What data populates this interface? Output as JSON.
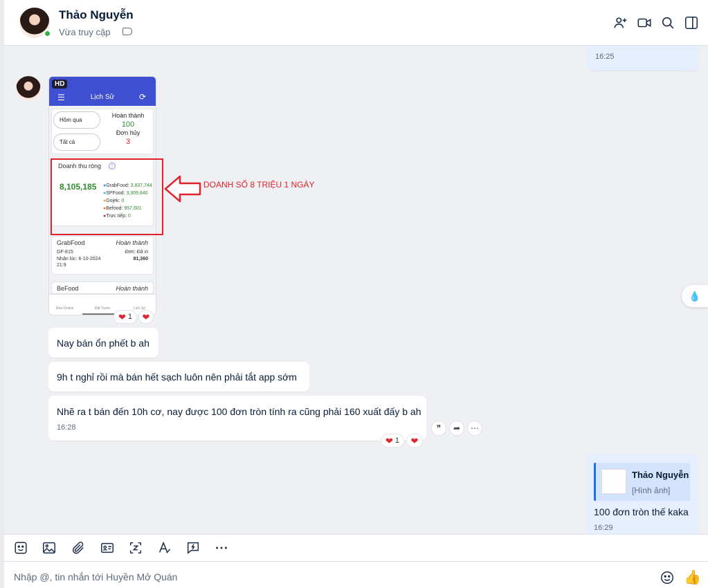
{
  "header": {
    "contact_name": "Thảo Nguyễn",
    "status": "Vừa truy cập"
  },
  "chat": {
    "top_time": "16:25",
    "image_message": {
      "hd_badge": "HD",
      "app_title": "Lịch Sử",
      "filter_yesterday": "Hôm qua",
      "filter_all": "Tất cả",
      "completed_label": "Hoàn thành",
      "completed_count": "100",
      "cancelled_label": "Đơn hủy",
      "cancelled_count": "3",
      "revenue_label": "Doanh thu ròng",
      "revenue_total": "8,105,185",
      "breakdown": [
        {
          "label": "GrabFood:",
          "value": "3,837,744",
          "color": "#3a8ee6"
        },
        {
          "label": "SPFood:",
          "value": "3,309,840",
          "color": "#35c6c9"
        },
        {
          "label": "Gojek:",
          "value": "0",
          "color": "#f2a93b"
        },
        {
          "label": "Befood:",
          "value": "957,601",
          "color": "#f7791e"
        },
        {
          "label": "Trực tiếp:",
          "value": "0",
          "color": "#c2187f"
        }
      ],
      "order1_platform": "GrabFood",
      "order1_status": "Hoàn thành",
      "order1_code": "GF-815",
      "order1_print": "Đơn: Đã in",
      "order1_received": "Nhận lúc: 6-10-2024",
      "order1_time": "21:9",
      "order1_amount": "81,360",
      "order2_platform": "BeFood",
      "order2_status": "Hoàn thành",
      "tabs": [
        "Đơn Online",
        "Đặt Trước",
        "Lịch Sử"
      ],
      "reaction_count": "1"
    },
    "annotation": "DOANH SỐ 8 TRIỆU 1 NGÀY",
    "messages": [
      {
        "text": "Nay bán ổn phết b ah"
      },
      {
        "text": "9h t nghỉ rồi mà bán hết sạch luôn nên phải tắt app sớm"
      },
      {
        "text": "Nhẽ ra t bán đến 10h cơ, nay được 100 đơn tròn tính ra cũng phải 160 xuất đấy b ah",
        "time": "16:28",
        "reaction_count": "1"
      }
    ],
    "reply": {
      "quoted_name": "Thảo Nguyễn",
      "quoted_text": "[Hình ảnh]",
      "text": "100 đơn tròn thế kaka",
      "time": "16:29"
    }
  },
  "composer": {
    "placeholder": "Nhập @, tin nhắn tới Huyền Mở Quán"
  },
  "colors": {
    "accent": "#3f4fd2",
    "annotation": "#e0232a",
    "online": "#34b24a"
  }
}
